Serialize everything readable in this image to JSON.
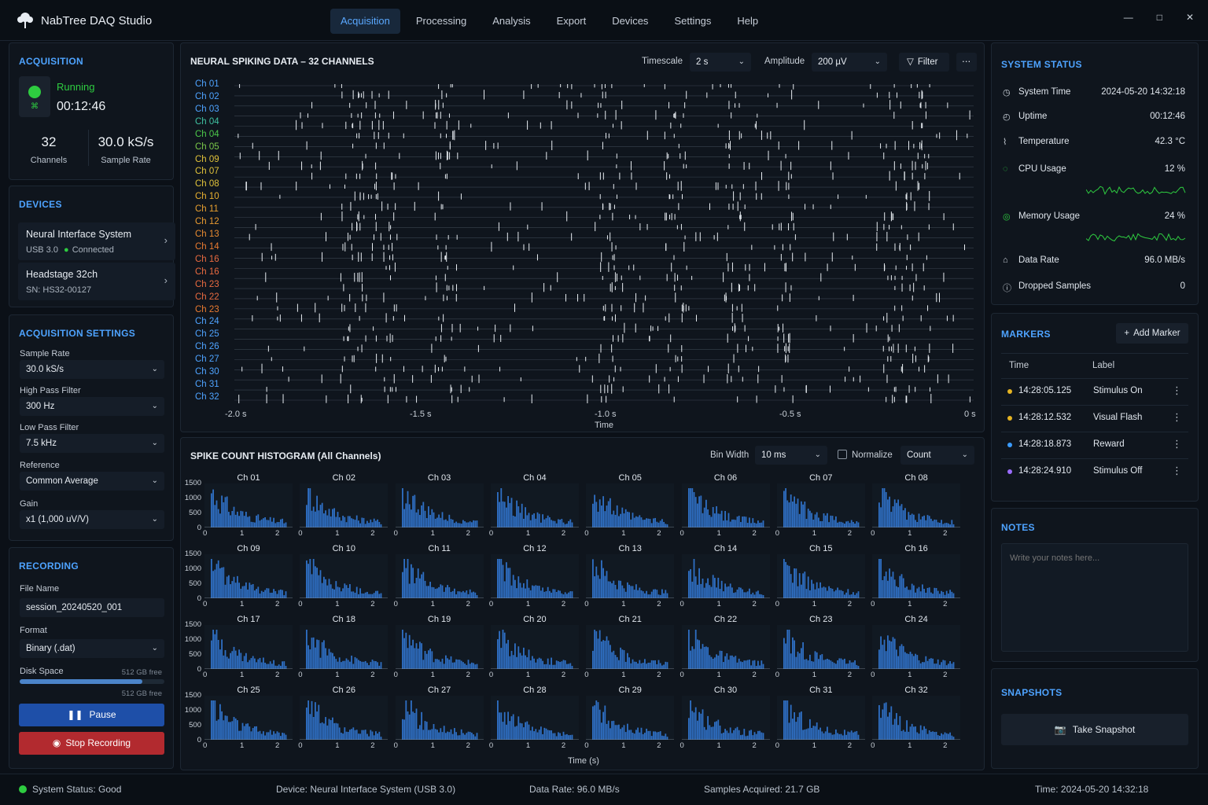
{
  "app": {
    "title": "NabTree DAQ Studio"
  },
  "nav": [
    "Acquisition",
    "Processing",
    "Analysis",
    "Export",
    "Devices",
    "Settings",
    "Help"
  ],
  "acq": {
    "title": "ACQUISITION",
    "state": "Running",
    "elapsed": "00:12:46",
    "channels": "32",
    "channels_label": "Channels",
    "rate": "30.0 kS/s",
    "rate_label": "Sample Rate"
  },
  "devices": {
    "title": "DEVICES",
    "items": [
      {
        "name": "Neural Interface System",
        "sub1": "USB 3.0",
        "sub2": "Connected"
      },
      {
        "name": "Headstage 32ch",
        "sub1": "SN: HS32-00127"
      }
    ]
  },
  "settings": {
    "title": "ACQUISITION SETTINGS",
    "fields": [
      {
        "label": "Sample Rate",
        "value": "30.0 kS/s"
      },
      {
        "label": "High Pass Filter",
        "value": "300 Hz"
      },
      {
        "label": "Low Pass Filter",
        "value": "7.5 kHz"
      },
      {
        "label": "Reference",
        "value": "Common Average"
      },
      {
        "label": "Gain",
        "value": "x1 (1,000 uV/V)"
      }
    ]
  },
  "recording": {
    "title": "RECORDING",
    "file_label": "File Name",
    "file_value": "session_20240520_001",
    "format_label": "Format",
    "format_value": "Binary (.dat)",
    "disk_label": "Disk Space",
    "disk_free": "512 GB free",
    "disk_free2": "512 GB free",
    "disk_used_fraction": 0.85,
    "pause": "Pause",
    "stop": "Stop Recording"
  },
  "raster": {
    "title": "NEURAL SPIKING DATA – 32 CHANNELS",
    "timescale_label": "Timescale",
    "timescale": "2 s",
    "amplitude_label": "Amplitude",
    "amplitude": "200 µV",
    "filter": "Filter",
    "channels": [
      "Ch 01",
      "Ch 02",
      "Ch 03",
      "Ch 04",
      "Ch 04",
      "Ch 05",
      "Ch 09",
      "Ch 07",
      "Ch 08",
      "Ch 10",
      "Ch 11",
      "Ch 12",
      "Ch 13",
      "Ch 14",
      "Ch 16",
      "Ch 16",
      "Ch 23",
      "Ch 22",
      "Ch 23",
      "Ch 24",
      "Ch 25",
      "Ch 26",
      "Ch 27",
      "Ch 30",
      "Ch 31",
      "Ch 32"
    ],
    "xticks": [
      "-2.0 s",
      "-1.5 s",
      "-1.0 s",
      "-0.5 s",
      "0 s"
    ],
    "xlabel": "Time"
  },
  "hist": {
    "title": "SPIKE COUNT HISTOGRAM (All Channels)",
    "bin_label": "Bin Width",
    "bin": "10 ms",
    "normalize": "Normalize",
    "mode": "Count",
    "channels": [
      "Ch 01",
      "Ch 02",
      "Ch 03",
      "Ch 04",
      "Ch 05",
      "Ch 06",
      "Ch 07",
      "Ch 08",
      "Ch 09",
      "Ch 10",
      "Ch 11",
      "Ch 12",
      "Ch 13",
      "Ch 14",
      "Ch 15",
      "Ch 16",
      "Ch 17",
      "Ch 18",
      "Ch 19",
      "Ch 20",
      "Ch 21",
      "Ch 22",
      "Ch 23",
      "Ch 24",
      "Ch 25",
      "Ch 26",
      "Ch 27",
      "Ch 28",
      "Ch 29",
      "Ch 30",
      "Ch 31",
      "Ch 32"
    ],
    "yticks": [
      "1500",
      "1000",
      "500",
      "0"
    ],
    "xticks": [
      "0",
      "1",
      "2"
    ],
    "xlabel": "Time (s)"
  },
  "sys": {
    "title": "SYSTEM STATUS",
    "rows": [
      {
        "icon": "clock-icon",
        "k": "System Time",
        "v": "2024-05-20 14:32:18"
      },
      {
        "icon": "uptime-icon",
        "k": "Uptime",
        "v": "00:12:46"
      },
      {
        "icon": "thermometer-icon",
        "k": "Temperature",
        "v": "42.3 °C"
      },
      {
        "icon": "cpu-icon",
        "k": "CPU Usage",
        "v": "12 %"
      },
      {
        "icon": "memory-icon",
        "k": "Memory Usage",
        "v": "24 %"
      },
      {
        "icon": "upload-icon",
        "k": "Data Rate",
        "v": "96.0 MB/s"
      },
      {
        "icon": "info-icon",
        "k": "Dropped Samples",
        "v": "0"
      }
    ]
  },
  "markers": {
    "title": "MARKERS",
    "add": "Add Marker",
    "col_time": "Time",
    "col_label": "Label",
    "rows": [
      {
        "t": "14:28:05.125",
        "l": "Stimulus On",
        "color": "#e6b422"
      },
      {
        "t": "14:28:12.532",
        "l": "Visual Flash",
        "color": "#e6b422"
      },
      {
        "t": "14:28:18.873",
        "l": "Reward",
        "color": "#3b9cff"
      },
      {
        "t": "14:28:24.910",
        "l": "Stimulus Off",
        "color": "#9b6cff"
      }
    ]
  },
  "notes": {
    "title": "NOTES",
    "placeholder": "Write your notes here..."
  },
  "snap": {
    "title": "SNAPSHOTS",
    "button": "Take Snapshot"
  },
  "statusbar": {
    "status": "System Status:  Good",
    "device": "Device: Neural Interface System (USB 3.0)",
    "rate": "Data Rate: 96.0 MB/s",
    "samples": "Samples Acquired: 21.7 GB",
    "time": "Time: 2024-05-20 14:32:18"
  },
  "colors": {
    "accent": "#4ea3ff",
    "running": "#2ecc40",
    "pause": "#1e4fa8",
    "stop": "#b22a2f",
    "bars": "#2f6fc4"
  }
}
